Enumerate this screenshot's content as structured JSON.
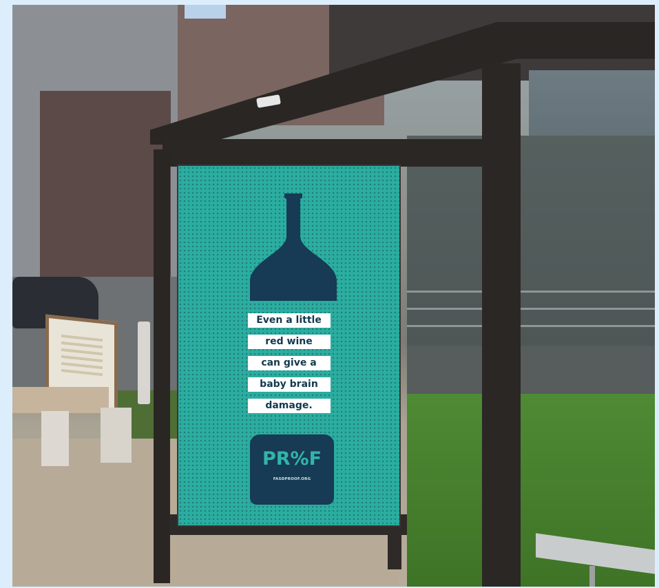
{
  "poster": {
    "headline_lines": [
      "Even a little",
      "red wine",
      "can give a",
      "baby brain",
      "damage."
    ],
    "logo_text": "PR%F",
    "url_text": "FASDPROOF.ORG"
  },
  "colors": {
    "poster_background": "#2bada0",
    "bottle_navy": "#173a55",
    "logo_teal": "#31b5a8",
    "headline_text": "#123a4d"
  },
  "icons": [
    "wine-bottle-icon"
  ]
}
